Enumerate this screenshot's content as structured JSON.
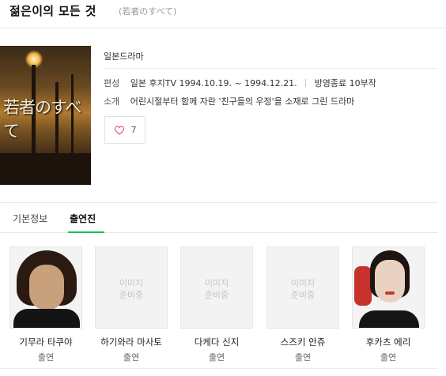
{
  "header": {
    "title": "젊은이의 모든 것",
    "subtitle": "(若者のすべて)"
  },
  "poster": {
    "text": "若者のすべて"
  },
  "info": {
    "genre": "일본드라마",
    "schedule_label": "편성",
    "schedule_value": "일본 후지TV 1994.10.19. ~ 1994.12.21.",
    "status_value": "방영종료 10부작",
    "summary_label": "소개",
    "summary_value": "어린시절부터 함께 자란 '친구들의 우정'을 소재로 그린 드라마"
  },
  "like": {
    "count": "7",
    "icon": "heart-outline-icon"
  },
  "tabs": [
    {
      "label": "기본정보",
      "active": false
    },
    {
      "label": "출연진",
      "active": true
    }
  ],
  "placeholder_text": "이미지\n준비중",
  "cast": [
    {
      "name": "기무라 타쿠야",
      "role": "출연",
      "has_photo": true
    },
    {
      "name": "하기와라 마사토",
      "role": "출연",
      "has_photo": false
    },
    {
      "name": "다케다 신지",
      "role": "출연",
      "has_photo": false
    },
    {
      "name": "스즈키 안쥬",
      "role": "출연",
      "has_photo": false
    },
    {
      "name": "후카츠 에리",
      "role": "출연",
      "has_photo": true
    }
  ],
  "colors": {
    "accent": "#03c75a",
    "like_heart": "#e0566b"
  }
}
